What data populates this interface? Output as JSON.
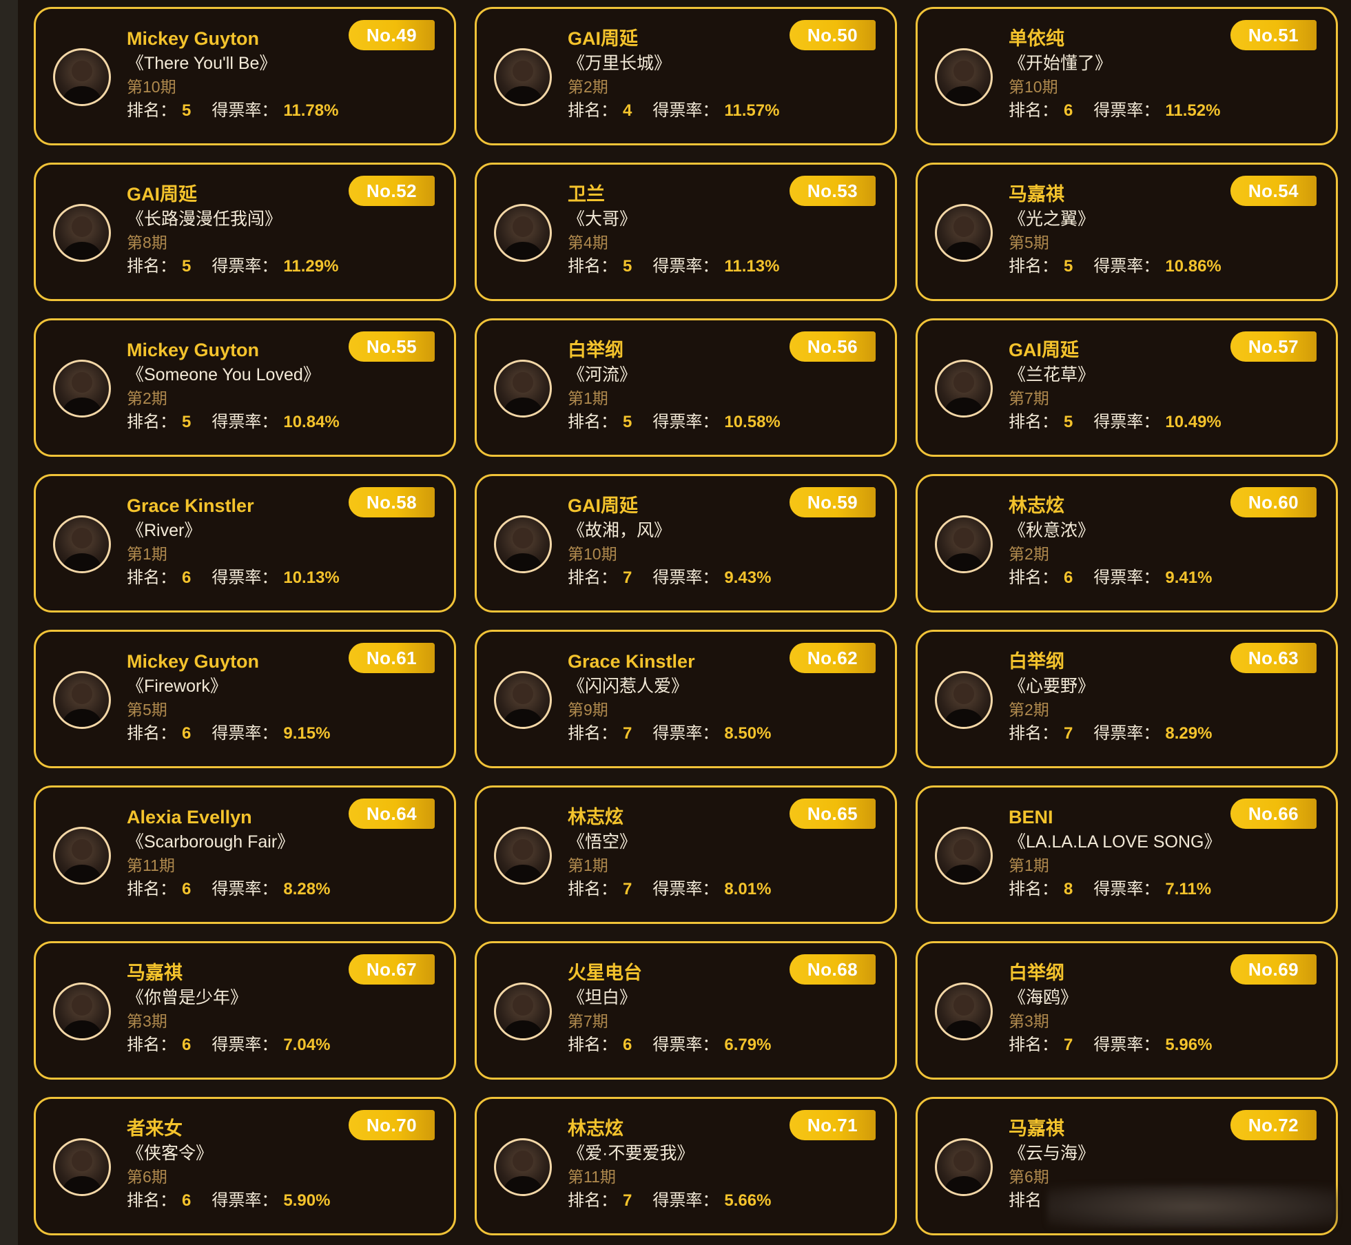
{
  "labels": {
    "rank": "排名：",
    "rate": "得票率：",
    "rank_truncated": "排名"
  },
  "cards": [
    {
      "no": "No.49",
      "name": "Mickey Guyton",
      "song": "《There You'll Be》",
      "episode": "第10期",
      "rank": "5",
      "rate": "11.78%"
    },
    {
      "no": "No.50",
      "name": "GAI周延",
      "song": "《万里长城》",
      "episode": "第2期",
      "rank": "4",
      "rate": "11.57%"
    },
    {
      "no": "No.51",
      "name": "单依纯",
      "song": "《开始懂了》",
      "episode": "第10期",
      "rank": "6",
      "rate": "11.52%"
    },
    {
      "no": "No.52",
      "name": "GAI周延",
      "song": "《长路漫漫任我闯》",
      "episode": "第8期",
      "rank": "5",
      "rate": "11.29%"
    },
    {
      "no": "No.53",
      "name": "卫兰",
      "song": "《大哥》",
      "episode": "第4期",
      "rank": "5",
      "rate": "11.13%"
    },
    {
      "no": "No.54",
      "name": "马嘉祺",
      "song": "《光之翼》",
      "episode": "第5期",
      "rank": "5",
      "rate": "10.86%"
    },
    {
      "no": "No.55",
      "name": "Mickey Guyton",
      "song": "《Someone You Loved》",
      "episode": "第2期",
      "rank": "5",
      "rate": "10.84%"
    },
    {
      "no": "No.56",
      "name": "白举纲",
      "song": "《河流》",
      "episode": "第1期",
      "rank": "5",
      "rate": "10.58%"
    },
    {
      "no": "No.57",
      "name": "GAI周延",
      "song": "《兰花草》",
      "episode": "第7期",
      "rank": "5",
      "rate": "10.49%"
    },
    {
      "no": "No.58",
      "name": "Grace Kinstler",
      "song": "《River》",
      "episode": "第1期",
      "rank": "6",
      "rate": "10.13%"
    },
    {
      "no": "No.59",
      "name": "GAI周延",
      "song": "《故湘，风》",
      "episode": "第10期",
      "rank": "7",
      "rate": "9.43%"
    },
    {
      "no": "No.60",
      "name": "林志炫",
      "song": "《秋意浓》",
      "episode": "第2期",
      "rank": "6",
      "rate": "9.41%"
    },
    {
      "no": "No.61",
      "name": "Mickey Guyton",
      "song": "《Firework》",
      "episode": "第5期",
      "rank": "6",
      "rate": "9.15%"
    },
    {
      "no": "No.62",
      "name": "Grace Kinstler",
      "song": "《闪闪惹人爱》",
      "episode": "第9期",
      "rank": "7",
      "rate": "8.50%"
    },
    {
      "no": "No.63",
      "name": "白举纲",
      "song": "《心要野》",
      "episode": "第2期",
      "rank": "7",
      "rate": "8.29%"
    },
    {
      "no": "No.64",
      "name": "Alexia Evellyn",
      "song": "《Scarborough Fair》",
      "episode": "第11期",
      "rank": "6",
      "rate": "8.28%"
    },
    {
      "no": "No.65",
      "name": "林志炫",
      "song": "《悟空》",
      "episode": "第1期",
      "rank": "7",
      "rate": "8.01%"
    },
    {
      "no": "No.66",
      "name": "BENI",
      "song": "《LA.LA.LA LOVE SONG》",
      "episode": "第1期",
      "rank": "8",
      "rate": "7.11%"
    },
    {
      "no": "No.67",
      "name": "马嘉祺",
      "song": "《你曾是少年》",
      "episode": "第3期",
      "rank": "6",
      "rate": "7.04%"
    },
    {
      "no": "No.68",
      "name": "火星电台",
      "song": "《坦白》",
      "episode": "第7期",
      "rank": "6",
      "rate": "6.79%"
    },
    {
      "no": "No.69",
      "name": "白举纲",
      "song": "《海鸥》",
      "episode": "第3期",
      "rank": "7",
      "rate": "5.96%"
    },
    {
      "no": "No.70",
      "name": "者来女",
      "song": "《侠客令》",
      "episode": "第6期",
      "rank": "6",
      "rate": "5.90%"
    },
    {
      "no": "No.71",
      "name": "林志炫",
      "song": "《爱·不要爱我》",
      "episode": "第11期",
      "rank": "7",
      "rate": "5.66%"
    },
    {
      "no": "No.72",
      "name": "马嘉祺",
      "song": "《云与海》",
      "episode": "第6期",
      "rank": "",
      "rate": "",
      "truncated": true
    }
  ],
  "colors": {
    "background": "#1b130d",
    "card_border": "#f1c338",
    "accent_gold": "#f4c32c",
    "text_light": "#f3ead8",
    "episode_text": "#b08a4e"
  }
}
